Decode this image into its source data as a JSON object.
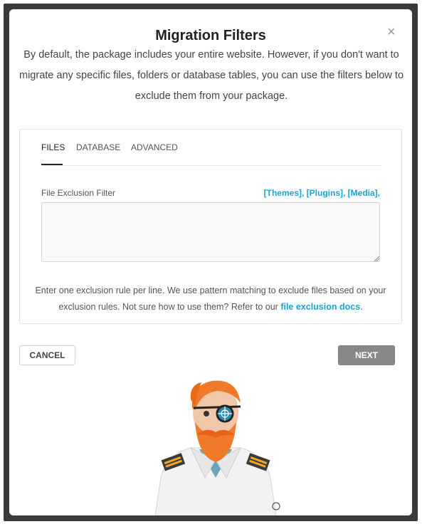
{
  "modal": {
    "title": "Migration Filters",
    "close_symbol": "×",
    "intro": "By default, the package includes your entire website. However, if you don't want to migrate any specific files, folders or database tables, you can use the filters below to exclude them from your package."
  },
  "tabs": [
    {
      "label": "FILES",
      "active": true
    },
    {
      "label": "DATABASE",
      "active": false
    },
    {
      "label": "ADVANCED",
      "active": false
    }
  ],
  "filter": {
    "label": "File Exclusion Filter",
    "quick_links": [
      "[Themes]",
      "[Plugins]",
      "[Media]"
    ],
    "value": ""
  },
  "help": {
    "text_before": "Enter one exclusion rule per line. We use pattern matching to exclude files based on your exclusion rules. Not sure how to use them? Refer to our ",
    "link": "file exclusion docs",
    "text_after": "."
  },
  "buttons": {
    "cancel": "CANCEL",
    "next": "NEXT"
  },
  "colors": {
    "accent": "#1aa3d9",
    "next_disabled": "#888888",
    "frame": "#3a3a3a"
  },
  "icons": {
    "close": "close-icon",
    "mascot": "mascot-illustration"
  }
}
